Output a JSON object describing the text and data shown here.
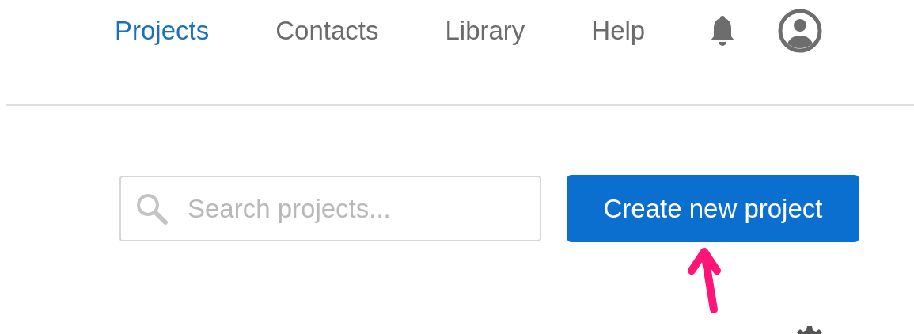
{
  "nav": {
    "items": [
      {
        "label": "Projects",
        "selected": true
      },
      {
        "label": "Contacts",
        "selected": false
      },
      {
        "label": "Library",
        "selected": false
      },
      {
        "label": "Help",
        "selected": false
      }
    ]
  },
  "search": {
    "placeholder": "Search projects..."
  },
  "create_button": {
    "label": "Create new project"
  }
}
